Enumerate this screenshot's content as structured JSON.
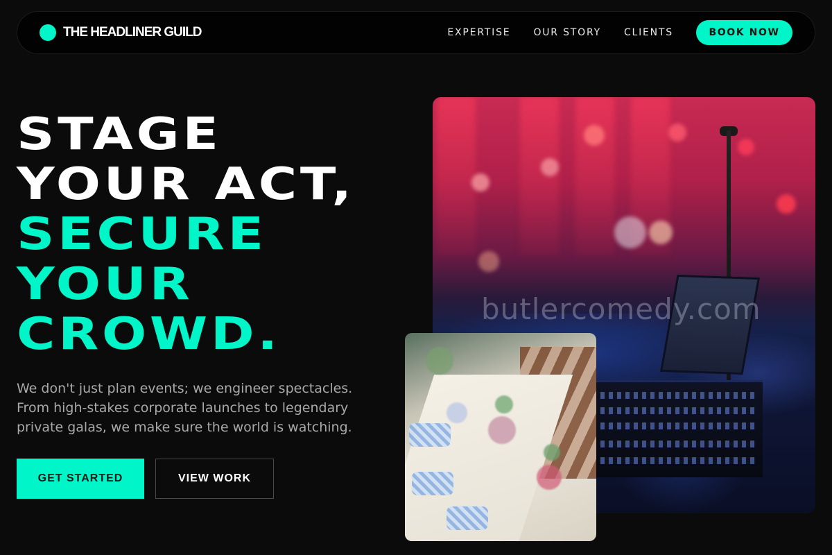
{
  "brand": {
    "name": "THE HEADLINER GUILD"
  },
  "nav": {
    "links": [
      "EXPERTISE",
      "OUR STORY",
      "CLIENTS"
    ],
    "cta": "BOOK NOW"
  },
  "hero": {
    "headline": {
      "line1": "STAGE",
      "line2": "YOUR ACT,",
      "line3": "SECURE",
      "line4": "YOUR",
      "line5": "CROWD."
    },
    "lead": "We don't just plan events; we engineer spectacles. From high-stakes corporate launches to legendary private galas, we make sure the world is watching.",
    "primary_button": "GET STARTED",
    "secondary_button": "VIEW WORK"
  },
  "images": {
    "watermark": "butlercomedy.com"
  },
  "colors": {
    "accent": "#00f5c8",
    "background": "#0b0b0b",
    "nav_background": "#020202"
  }
}
